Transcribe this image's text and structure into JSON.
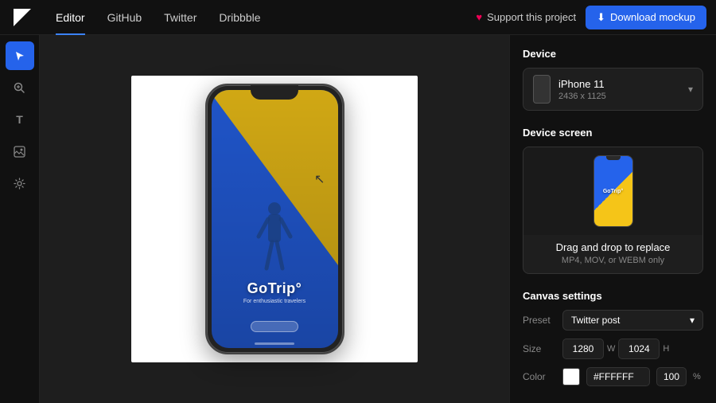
{
  "nav": {
    "logo_symbol": "◣",
    "links": [
      "Editor",
      "GitHub",
      "Twitter",
      "Dribbble"
    ],
    "active_link": "Editor",
    "support_label": "Support this project",
    "download_label": "Download mockup",
    "download_icon": "⬇"
  },
  "sidebar": {
    "icons": [
      {
        "name": "cursor-icon",
        "symbol": "↖",
        "active": true
      },
      {
        "name": "zoom-icon",
        "symbol": "⊕",
        "active": false
      },
      {
        "name": "text-icon",
        "symbol": "T",
        "active": false
      },
      {
        "name": "image-icon",
        "symbol": "⊞",
        "active": false
      },
      {
        "name": "settings-icon",
        "symbol": "⚙",
        "active": false
      }
    ]
  },
  "right_panel": {
    "device_section": {
      "label": "Device",
      "device_name": "iPhone 11",
      "device_resolution": "2436 x 1125"
    },
    "screen_section": {
      "label": "Device screen",
      "drop_title": "Drag and drop to replace",
      "drop_subtitle": "MP4, MOV, or WEBM only"
    },
    "canvas_section": {
      "label": "Canvas settings",
      "preset_label": "Preset",
      "preset_value": "Twitter post",
      "size_label": "Size",
      "width_value": "1280",
      "width_unit": "W",
      "height_value": "1024",
      "height_unit": "H",
      "color_label": "Color",
      "color_hex": "#FFFFFF",
      "opacity_value": "100",
      "opacity_unit": "%"
    }
  },
  "canvas": {
    "app_name": "GoTrip°",
    "app_tagline": "For enthusiastic travelers"
  }
}
